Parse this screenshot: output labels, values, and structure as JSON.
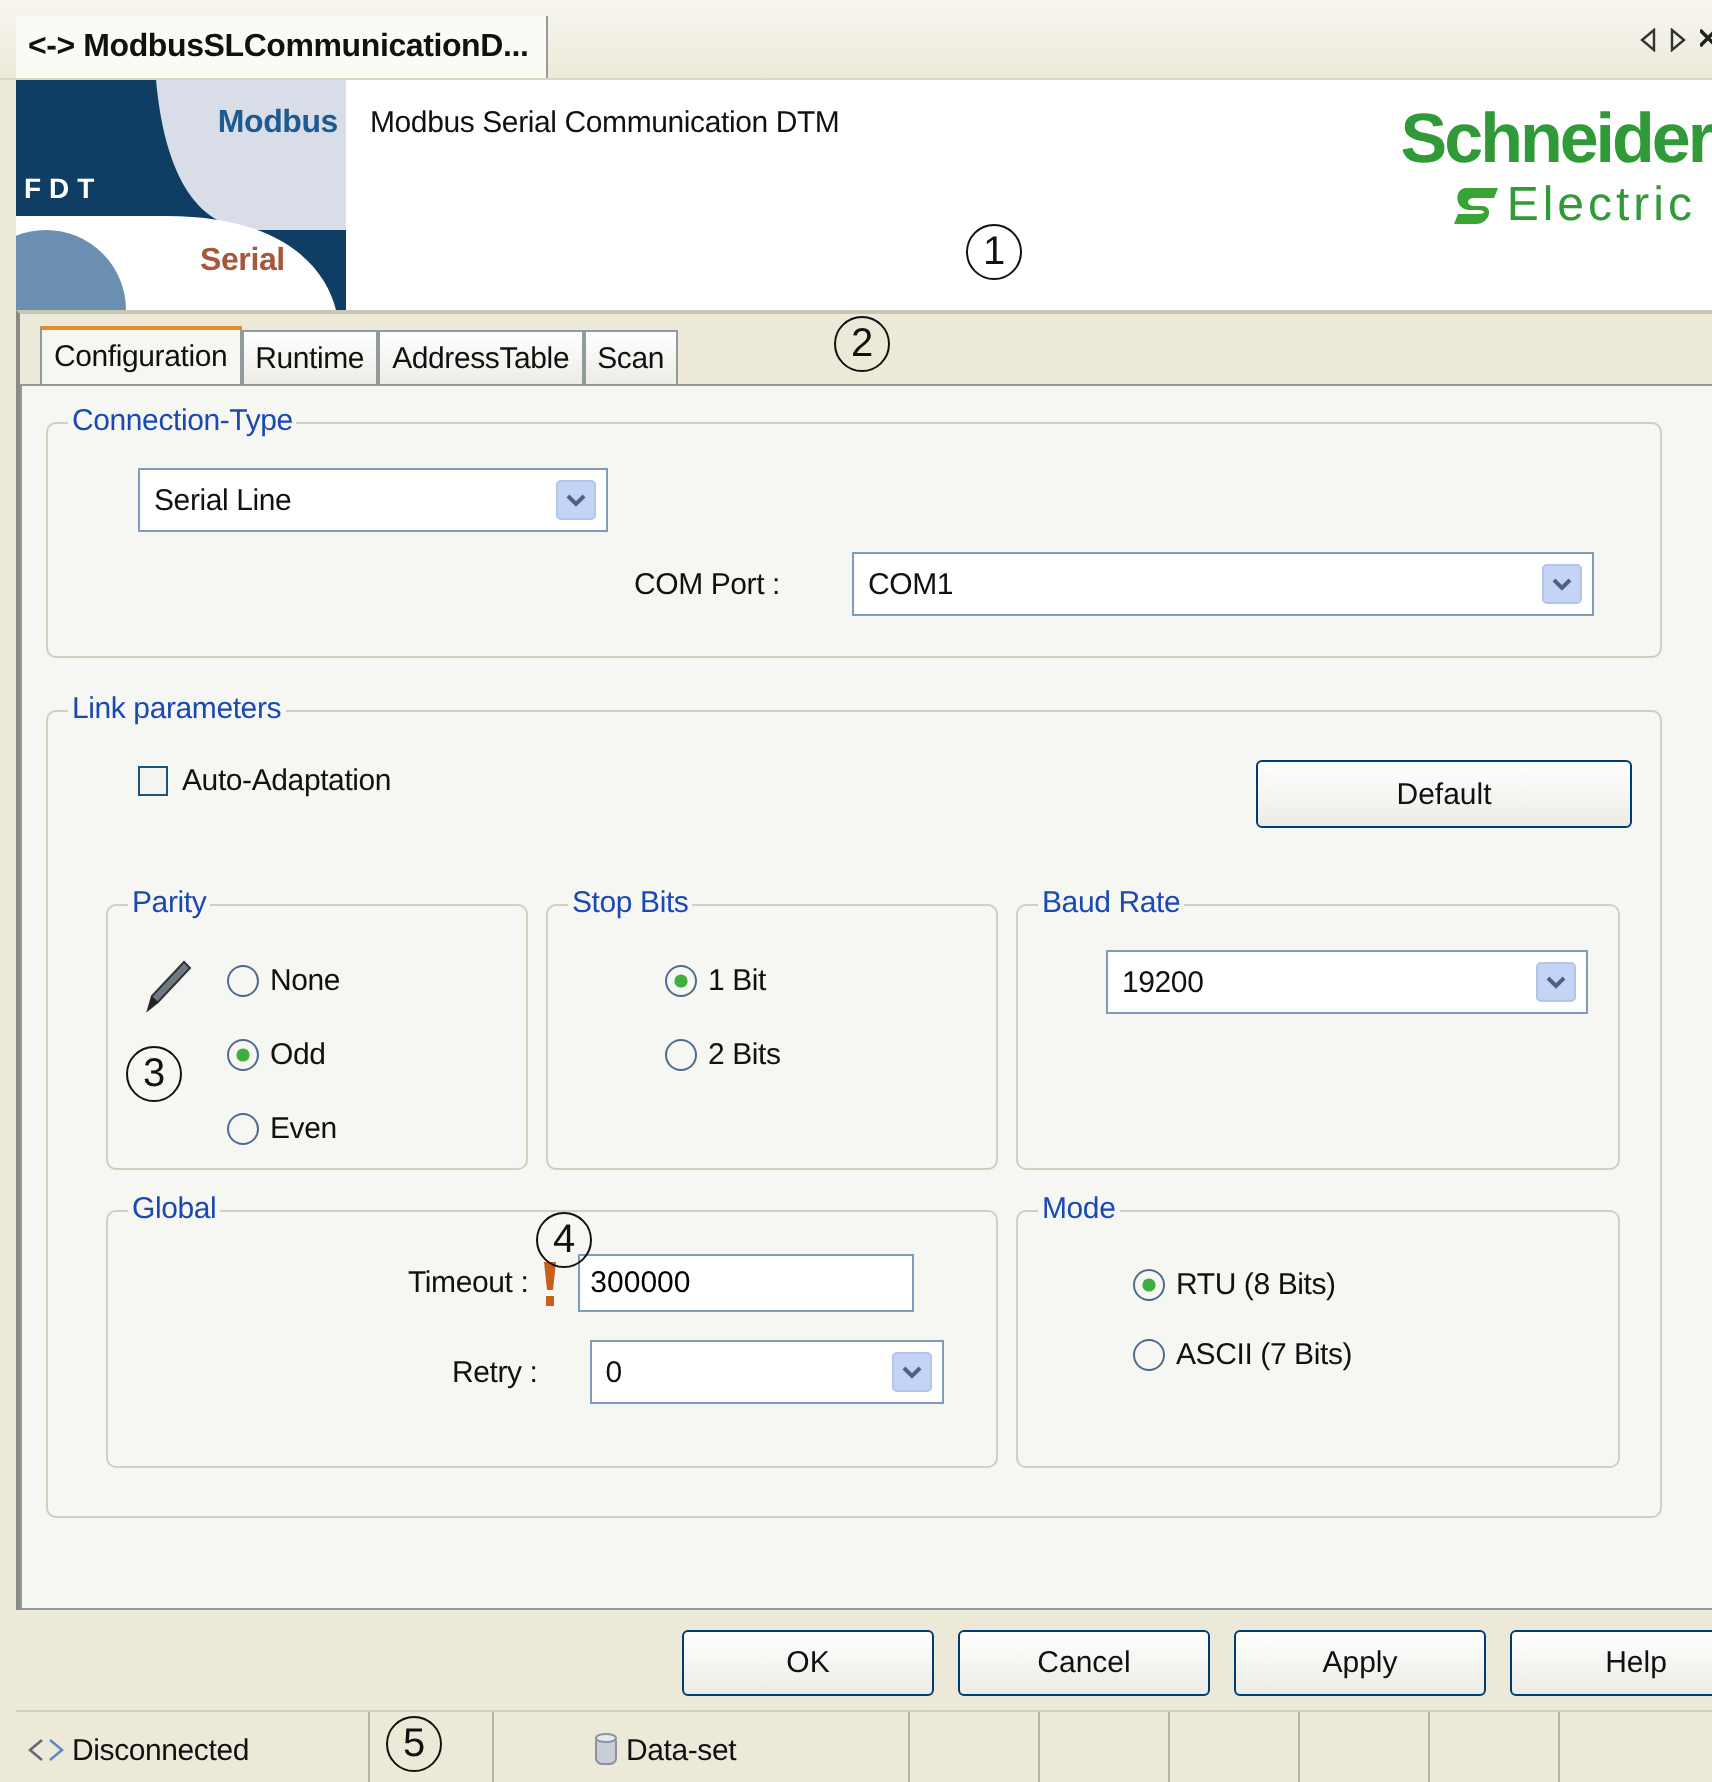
{
  "document_tab": {
    "title": "<-> ModbusSLCommunicationD..."
  },
  "header": {
    "logo_top": "Modbus",
    "logo_mark": "FDT",
    "logo_bottom": "Serial",
    "title": "Modbus Serial Communication DTM",
    "brand_name": "Schneider",
    "brand_sub": "Electric"
  },
  "tabs": [
    {
      "label": "Configuration",
      "selected": true
    },
    {
      "label": "Runtime",
      "selected": false
    },
    {
      "label": "AddressTable",
      "selected": false
    },
    {
      "label": "Scan",
      "selected": false
    }
  ],
  "connection_type": {
    "legend": "Connection-Type",
    "type": "Serial Line",
    "com_port_label": "COM Port :",
    "com_port": "COM1"
  },
  "link_parameters": {
    "legend": "Link parameters",
    "auto_adaptation": {
      "label": "Auto-Adaptation",
      "checked": false
    },
    "default_button": "Default",
    "parity": {
      "legend": "Parity",
      "options": [
        {
          "label": "None",
          "selected": false
        },
        {
          "label": "Odd",
          "selected": true
        },
        {
          "label": "Even",
          "selected": false
        }
      ]
    },
    "stop_bits": {
      "legend": "Stop Bits",
      "options": [
        {
          "label": "1 Bit",
          "selected": true
        },
        {
          "label": "2 Bits",
          "selected": false
        }
      ]
    },
    "baud_rate": {
      "legend": "Baud Rate",
      "value": "19200"
    },
    "global": {
      "legend": "Global",
      "timeout_label": "Timeout :",
      "timeout": "300000",
      "retry_label": "Retry :",
      "retry": "0"
    },
    "mode": {
      "legend": "Mode",
      "options": [
        {
          "label": "RTU (8 Bits)",
          "selected": true
        },
        {
          "label": "ASCII (7 Bits)",
          "selected": false
        }
      ]
    }
  },
  "buttons": [
    "OK",
    "Cancel",
    "Apply",
    "Help"
  ],
  "status_bar": {
    "connection": "Disconnected",
    "dataset": "Data-set"
  },
  "callouts": [
    {
      "number": "1"
    },
    {
      "number": "2"
    },
    {
      "number": "3"
    },
    {
      "number": "4"
    },
    {
      "number": "5"
    }
  ]
}
